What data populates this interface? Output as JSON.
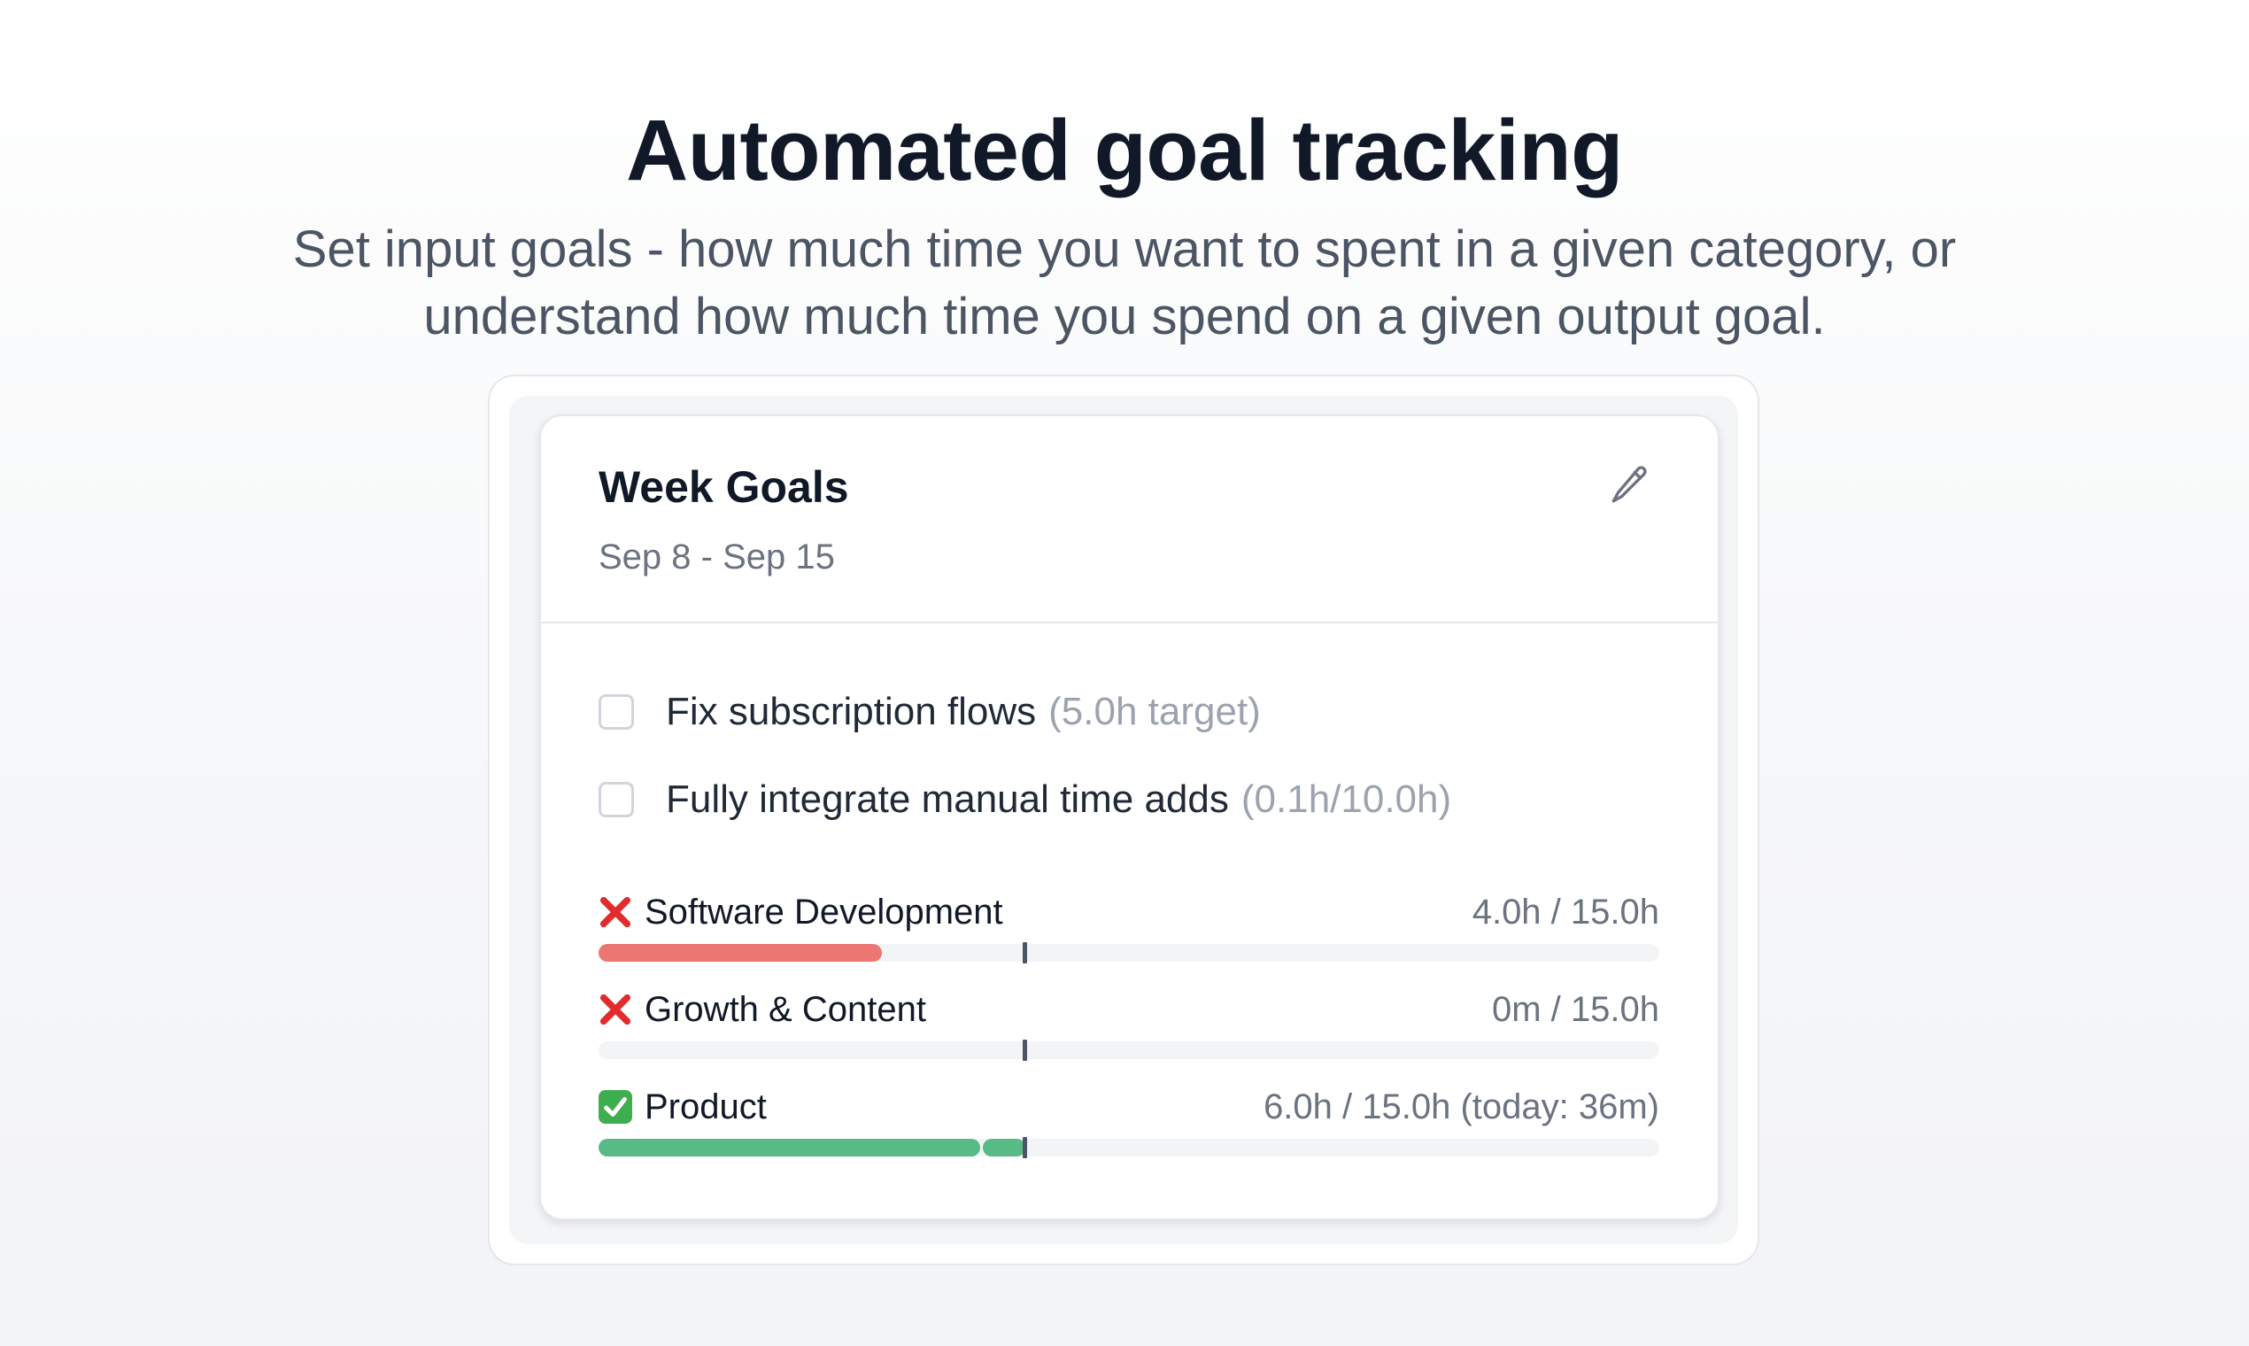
{
  "hero": {
    "title": "Automated goal tracking",
    "subtitle": "Set input goals - how much time you want to spent in a given category, or understand how much time you spend on a given output goal."
  },
  "card": {
    "title": "Week Goals",
    "date_range": "Sep 8 - Sep 15",
    "edit_icon": "pencil-icon",
    "output_goals": [
      {
        "label": "Fix subscription flows",
        "meta": "(5.0h target)",
        "checked": false
      },
      {
        "label": "Fully integrate manual time adds",
        "meta": "(0.1h/10.0h)",
        "checked": false
      }
    ],
    "input_goals": [
      {
        "status": "failed",
        "status_icon": "cross-mark-icon",
        "name": "Software Development",
        "value": "4.0h / 15.0h",
        "progress": 0.267,
        "today_progress": 0,
        "expected_marker": 0.4,
        "color": "#ec7672"
      },
      {
        "status": "failed",
        "status_icon": "cross-mark-icon",
        "name": "Growth & Content",
        "value": "0m / 15.0h",
        "progress": 0,
        "today_progress": 0,
        "expected_marker": 0.4,
        "color": "#ec7672"
      },
      {
        "status": "on-track",
        "status_icon": "check-mark-icon",
        "name": "Product",
        "value": "6.0h / 15.0h (today: 36m)",
        "progress": 0.36,
        "today_progress": 0.04,
        "expected_marker": 0.4,
        "color": "#58bb86"
      }
    ]
  },
  "colors": {
    "title": "#111827",
    "subtitle": "#4b5563",
    "muted": "#6b7280",
    "meta": "#9ca3af",
    "failed": "#ec7672",
    "success": "#58bb86",
    "cross": "#e02c2c",
    "check_bg": "#3fae4f"
  }
}
